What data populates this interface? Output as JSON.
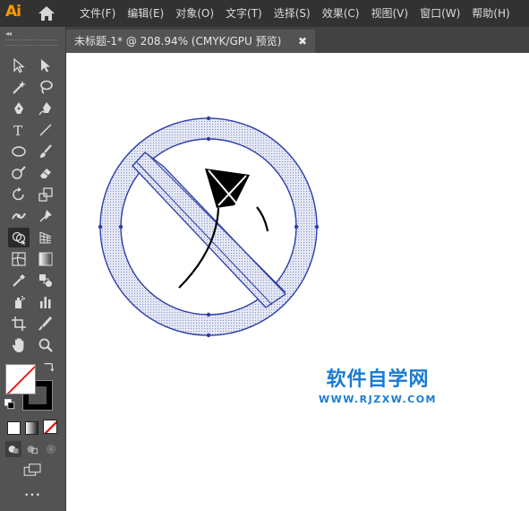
{
  "app": {
    "logo": "Ai"
  },
  "menubar": {
    "items": [
      {
        "label": "文件(F)"
      },
      {
        "label": "编辑(E)"
      },
      {
        "label": "对象(O)"
      },
      {
        "label": "文字(T)"
      },
      {
        "label": "选择(S)"
      },
      {
        "label": "效果(C)"
      },
      {
        "label": "视图(V)"
      },
      {
        "label": "窗口(W)"
      },
      {
        "label": "帮助(H)"
      }
    ]
  },
  "toolbar": {
    "collapse_glyph": "◂◂",
    "tools": [
      {
        "name": "selection-tool",
        "icon": "arrow-outline"
      },
      {
        "name": "direct-selection-tool",
        "icon": "arrow-filled"
      },
      {
        "name": "magic-wand-tool",
        "icon": "wand"
      },
      {
        "name": "lasso-tool",
        "icon": "lasso"
      },
      {
        "name": "pen-tool",
        "icon": "pen"
      },
      {
        "name": "curvature-tool",
        "icon": "curvature-pen"
      },
      {
        "name": "type-tool",
        "icon": "T"
      },
      {
        "name": "line-segment-tool",
        "icon": "line"
      },
      {
        "name": "ellipse-tool",
        "icon": "ellipse"
      },
      {
        "name": "paintbrush-tool",
        "icon": "brush"
      },
      {
        "name": "shaper-tool",
        "icon": "shaper"
      },
      {
        "name": "eraser-tool",
        "icon": "eraser"
      },
      {
        "name": "rotate-tool",
        "icon": "rotate"
      },
      {
        "name": "scale-tool",
        "icon": "scale"
      },
      {
        "name": "width-tool",
        "icon": "width"
      },
      {
        "name": "puppet-warp-tool",
        "icon": "pin"
      },
      {
        "name": "shape-builder-tool",
        "icon": "shape-builder",
        "active": true
      },
      {
        "name": "perspective-grid-tool",
        "icon": "perspective"
      },
      {
        "name": "mesh-tool",
        "icon": "mesh"
      },
      {
        "name": "gradient-tool",
        "icon": "gradient"
      },
      {
        "name": "eyedropper-tool",
        "icon": "eyedropper"
      },
      {
        "name": "blend-tool",
        "icon": "blend"
      },
      {
        "name": "symbol-sprayer-tool",
        "icon": "spray"
      },
      {
        "name": "column-graph-tool",
        "icon": "bar-graph"
      },
      {
        "name": "artboard-tool",
        "icon": "artboard"
      },
      {
        "name": "slice-tool",
        "icon": "knife"
      },
      {
        "name": "hand-tool",
        "icon": "hand"
      },
      {
        "name": "zoom-tool",
        "icon": "magnifier"
      }
    ],
    "fill_color": "#ffffff",
    "stroke_color": "#000000",
    "more_glyph": "•••"
  },
  "document": {
    "tab_title": "未标题-1* @ 208.94% (CMYK/GPU 预览)",
    "close_glyph": "✖"
  },
  "watermark": {
    "title": "软件自学网",
    "url": "WWW.RJZXW.COM",
    "color": "#1a7bd0"
  },
  "colors": {
    "menubar_bg": "#323232",
    "toolbar_bg": "#535353",
    "selection_blue": "#2b3ea8",
    "accent_orange": "#ff9a00"
  }
}
